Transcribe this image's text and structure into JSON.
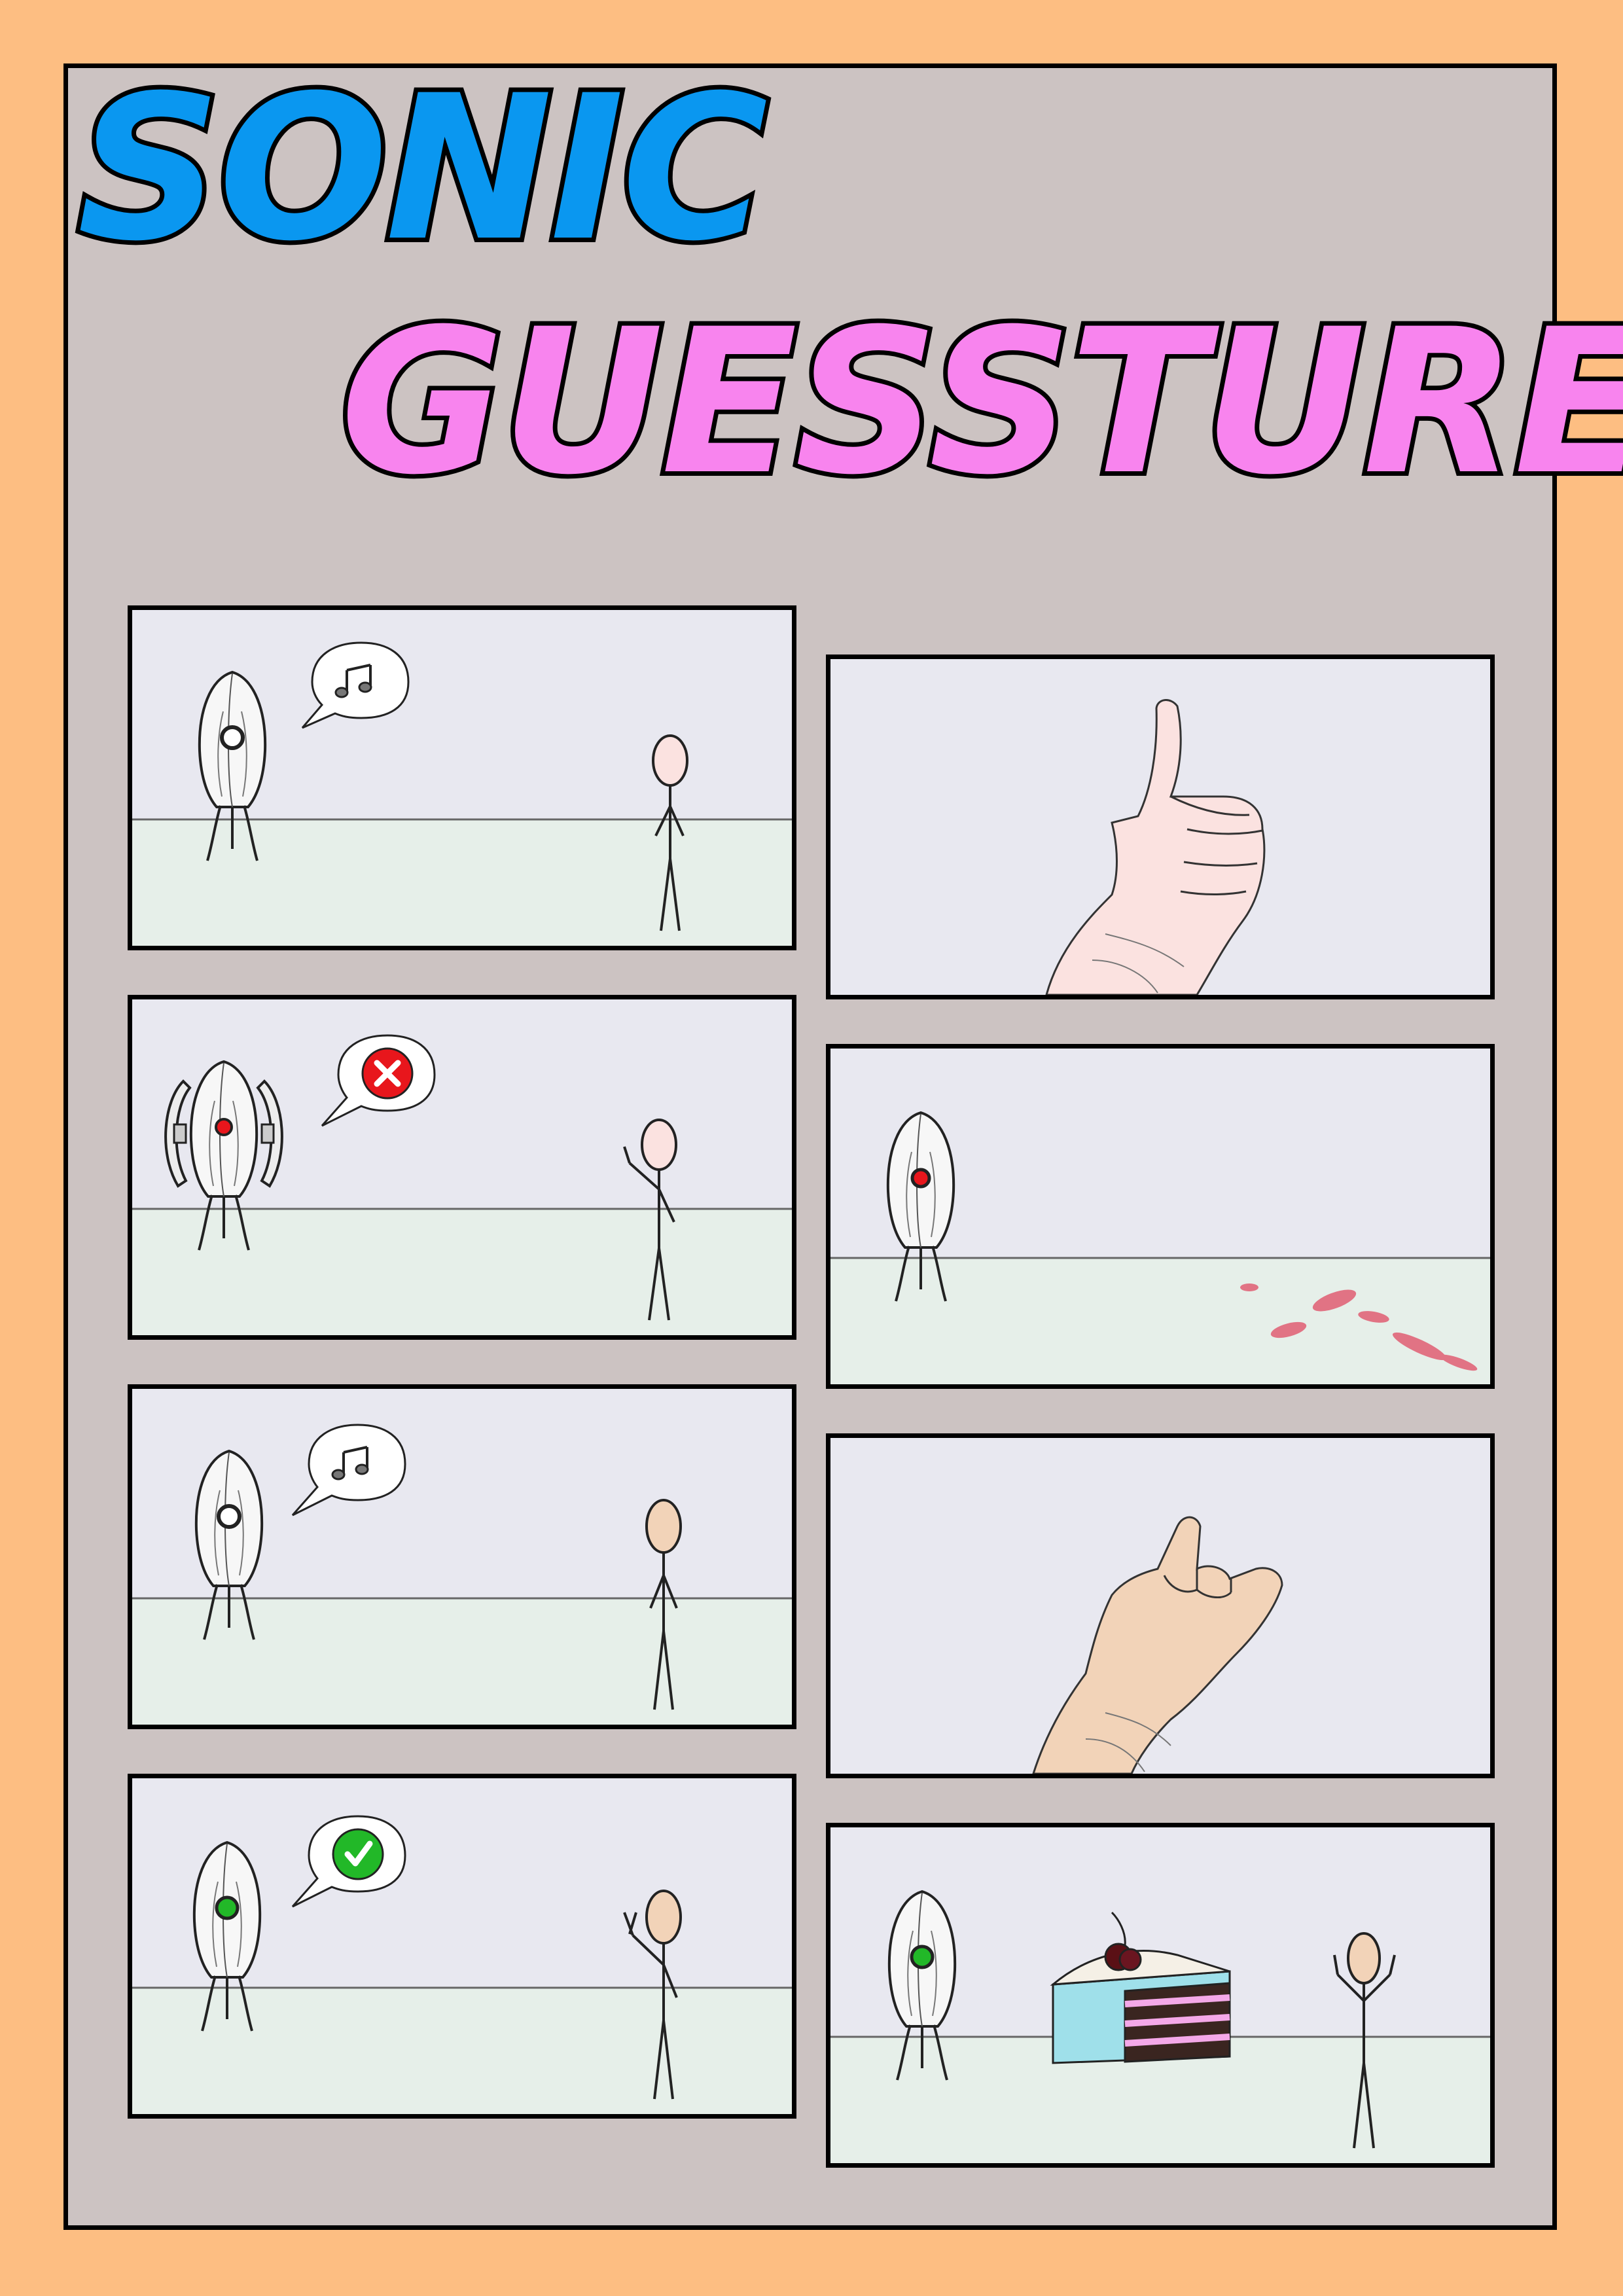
{
  "comic": {
    "title_line1": "SONIC",
    "title_line2": "GUESSTURE"
  },
  "colors": {
    "page_background": "#FDBE82",
    "sheet_background": "#CCC3C2",
    "title_line1": "#0A97F0",
    "title_line2": "#F884EE",
    "panel_wall": "#E8E8F0",
    "panel_floor": "#E6EFE9",
    "eye_neutral": "#FFFFFF",
    "eye_red": "#E8161C",
    "eye_green": "#22B828"
  },
  "panels": [
    {
      "column": "left",
      "row": 1,
      "bubble_icon": "music-notes-icon",
      "turret_eye": "neutral",
      "figure_gesture": "standing"
    },
    {
      "column": "left",
      "row": 2,
      "bubble_icon": "x-mark-icon",
      "turret_eye": "red",
      "turret_armed": true,
      "figure_gesture": "thumbs-up"
    },
    {
      "column": "left",
      "row": 3,
      "bubble_icon": "music-notes-icon",
      "turret_eye": "neutral",
      "figure_gesture": "standing"
    },
    {
      "column": "left",
      "row": 4,
      "bubble_icon": "check-mark-icon",
      "turret_eye": "green",
      "figure_gesture": "rock-hand"
    },
    {
      "column": "right",
      "row": 1,
      "content": "thumbs-up-hand-icon"
    },
    {
      "column": "right",
      "row": 2,
      "content": "turret-with-blood-splatter",
      "turret_eye": "red"
    },
    {
      "column": "right",
      "row": 3,
      "content": "rock-hand-gesture-icon"
    },
    {
      "column": "right",
      "row": 4,
      "content": "turret-cake-figure",
      "turret_eye": "green",
      "figure_gesture": "arms-raised"
    }
  ]
}
